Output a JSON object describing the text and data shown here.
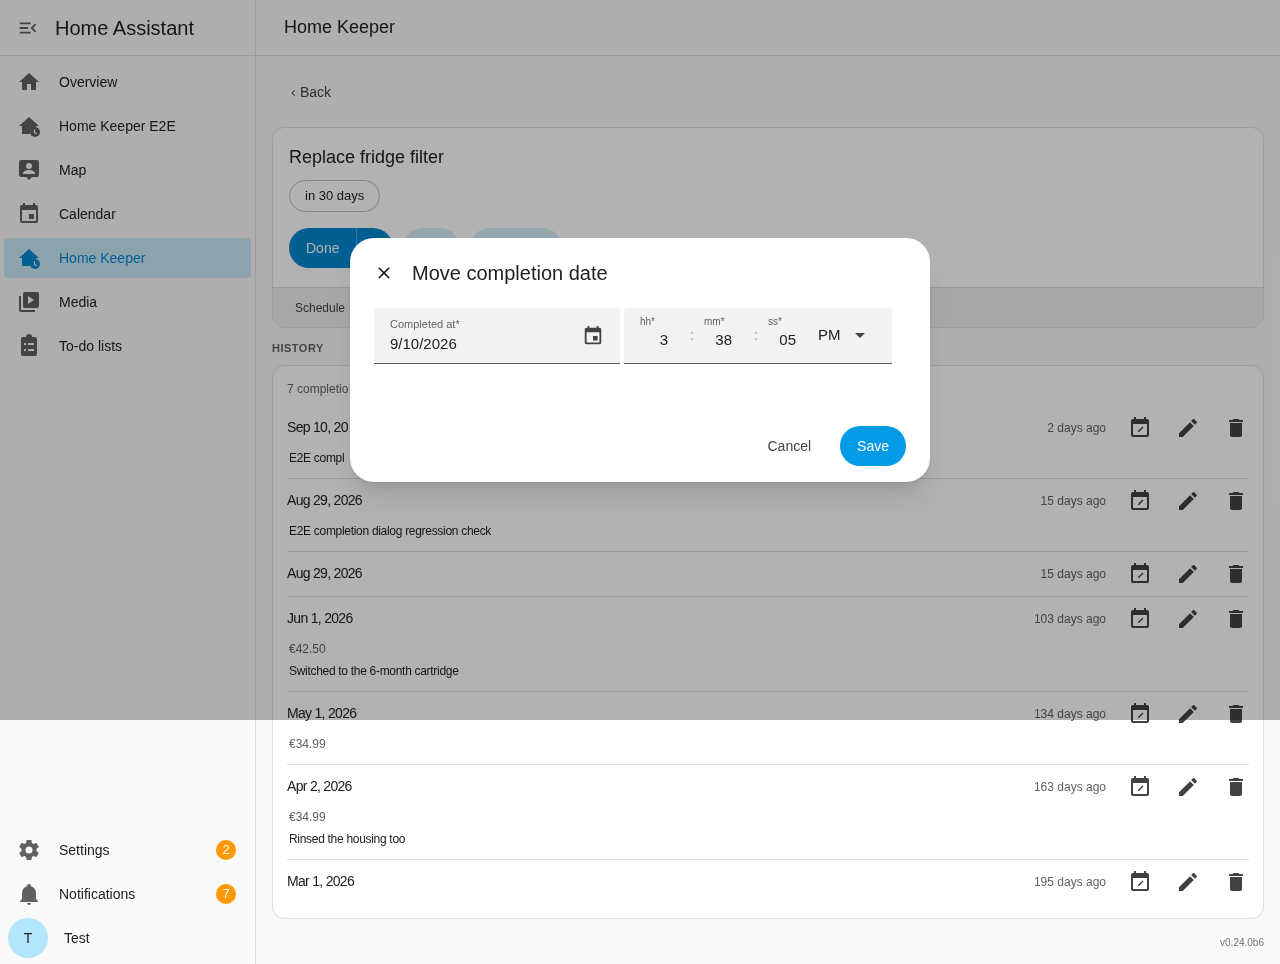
{
  "sidebar": {
    "title": "Home Assistant",
    "items": [
      {
        "label": "Overview",
        "selected": false
      },
      {
        "label": "Home Keeper E2E",
        "selected": false
      },
      {
        "label": "Map",
        "selected": false
      },
      {
        "label": "Calendar",
        "selected": false
      },
      {
        "label": "Home Keeper",
        "selected": true
      },
      {
        "label": "Media",
        "selected": false
      },
      {
        "label": "To-do lists",
        "selected": false
      }
    ],
    "bottom_items": [
      {
        "label": "Settings",
        "badge": "2"
      },
      {
        "label": "Notifications",
        "badge": "7"
      }
    ],
    "user": {
      "initial": "T",
      "name": "Test"
    }
  },
  "header": {
    "title": "Home Keeper"
  },
  "back": "Back",
  "task": {
    "title": "Replace fridge filter",
    "chip": "in 30 days",
    "actions": [
      {
        "label": "Done",
        "kind": "primary"
      },
      {
        "kind": "short"
      },
      {
        "kind": "long"
      }
    ],
    "tabs": [
      "Schedule"
    ]
  },
  "history": {
    "heading": "HISTORY",
    "summary": "7 completio",
    "rows": [
      {
        "date": "Sep 10, 20",
        "ago": "2 days ago",
        "note": "E2E compl"
      },
      {
        "date": "Aug 29, 2026",
        "ago": "15 days ago",
        "note": "E2E completion dialog regression check"
      },
      {
        "date": "Aug 29, 2026",
        "ago": "15 days ago"
      },
      {
        "date": "Jun 1, 2026",
        "ago": "103 days ago",
        "cost": "€42.50",
        "note": "Switched to the 6-month cartridge"
      },
      {
        "date": "May 1, 2026",
        "ago": "134 days ago",
        "cost": "€34.99"
      },
      {
        "date": "Apr 2, 2026",
        "ago": "163 days ago",
        "cost": "€34.99",
        "note": "Rinsed the housing too"
      },
      {
        "date": "Mar 1, 2026",
        "ago": "195 days ago"
      }
    ]
  },
  "version": "v0.24.0b6",
  "dialog": {
    "title": "Move completion date",
    "date_field": {
      "label": "Completed at*",
      "value": "9/10/2026"
    },
    "time_field": {
      "hours_label": "hh*",
      "hours": "3",
      "minutes_label": "mm*",
      "minutes": "38",
      "seconds_label": "ss*",
      "seconds": "05",
      "separator": ":",
      "period": "PM"
    },
    "buttons": [
      {
        "label": "Cancel",
        "kind": "text"
      },
      {
        "label": "Save",
        "kind": "primary"
      }
    ]
  }
}
